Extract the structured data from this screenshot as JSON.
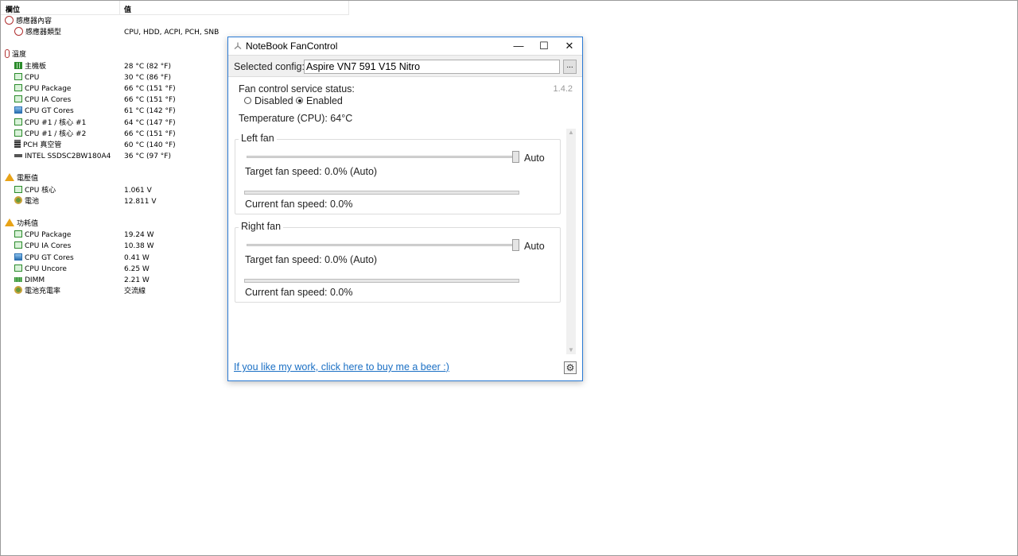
{
  "sensors": {
    "columns": {
      "field": "欄位",
      "value": "值"
    },
    "rows": [
      {
        "type": "group",
        "icon": "gauge-icon",
        "name": "感應器內容",
        "value": ""
      },
      {
        "type": "item",
        "icon": "gauge-icon",
        "name": "感應器類型",
        "value": "CPU, HDD, ACPI, PCH, SNB"
      },
      {
        "type": "group",
        "icon": "thermometer-icon",
        "name": "溫度",
        "value": ""
      },
      {
        "type": "item",
        "icon": "motherboard-icon",
        "name": "主機板",
        "value": "28 °C  (82 °F)"
      },
      {
        "type": "item",
        "icon": "chip-icon",
        "name": "CPU",
        "value": "30 °C  (86 °F)"
      },
      {
        "type": "item",
        "icon": "chip-icon",
        "name": "CPU Package",
        "value": "66 °C  (151 °F)"
      },
      {
        "type": "item",
        "icon": "chip-icon",
        "name": "CPU IA Cores",
        "value": "66 °C  (151 °F)"
      },
      {
        "type": "item",
        "icon": "gpu-icon",
        "name": "CPU GT Cores",
        "value": "61 °C  (142 °F)"
      },
      {
        "type": "item",
        "icon": "chip-icon",
        "name": "CPU #1 / 核心 #1",
        "value": "64 °C  (147 °F)"
      },
      {
        "type": "item",
        "icon": "chip-icon",
        "name": "CPU #1 / 核心 #2",
        "value": "66 °C  (151 °F)"
      },
      {
        "type": "item",
        "icon": "pch-icon",
        "name": "PCH 真空管",
        "value": "60 °C  (140 °F)"
      },
      {
        "type": "item",
        "icon": "disk-icon",
        "name": "INTEL SSDSC2BW180A4",
        "value": "36 °C  (97 °F)"
      },
      {
        "type": "group",
        "icon": "warning-icon",
        "name": "電壓值",
        "value": ""
      },
      {
        "type": "item",
        "icon": "chip-icon",
        "name": "CPU 核心",
        "value": "1.061 V"
      },
      {
        "type": "item",
        "icon": "battery-icon",
        "name": "電池",
        "value": "12.811 V"
      },
      {
        "type": "group",
        "icon": "warning-icon",
        "name": "功耗值",
        "value": ""
      },
      {
        "type": "item",
        "icon": "chip-icon",
        "name": "CPU Package",
        "value": "19.24 W"
      },
      {
        "type": "item",
        "icon": "chip-icon",
        "name": "CPU IA Cores",
        "value": "10.38 W"
      },
      {
        "type": "item",
        "icon": "gpu-icon",
        "name": "CPU GT Cores",
        "value": "0.41 W"
      },
      {
        "type": "item",
        "icon": "chip-icon",
        "name": "CPU Uncore",
        "value": "6.25 W"
      },
      {
        "type": "item",
        "icon": "dimm-icon",
        "name": "DIMM",
        "value": "2.21 W"
      },
      {
        "type": "item",
        "icon": "battery-icon",
        "name": "電池充電率",
        "value": "交流線"
      }
    ]
  },
  "fan_window": {
    "title": "NoteBook FanControl",
    "controls": {
      "minimize": "—",
      "maximize": "☐",
      "close": "✕"
    },
    "config": {
      "label": "Selected config:",
      "value": "Aspire VN7 591 V15 Nitro",
      "browse_label": "..."
    },
    "version": "1.4.2",
    "service": {
      "label": "Fan control service status:",
      "options": [
        "Disabled",
        "Enabled"
      ],
      "selected": "Enabled"
    },
    "temperature": "Temperature (CPU):  64°C",
    "fans": [
      {
        "title": "Left fan",
        "auto_label": "Auto",
        "target": "Target fan speed:  0.0% (Auto)",
        "current": "Current fan speed:  0.0%",
        "speed_fraction": 0.0
      },
      {
        "title": "Right fan",
        "auto_label": "Auto",
        "target": "Target fan speed:  0.0% (Auto)",
        "current": "Current fan speed:  0.0%",
        "speed_fraction": 0.0
      }
    ],
    "beer_link": "If you like my work, click here to buy me a beer :)",
    "settings_icon": "gear-icon"
  }
}
